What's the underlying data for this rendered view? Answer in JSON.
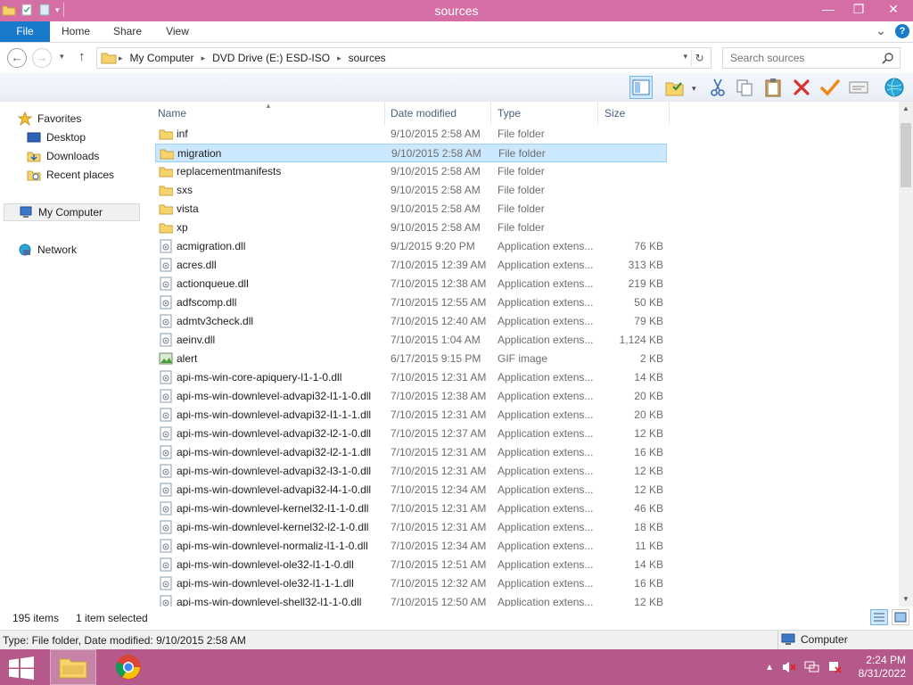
{
  "window": {
    "title": "sources"
  },
  "window_controls": {
    "minimize": "—",
    "maximize": "❐",
    "close": "✕"
  },
  "ribbon": {
    "tabs": [
      "File",
      "Home",
      "Share",
      "View"
    ],
    "expand_glyph": "⌄",
    "help_glyph": "?"
  },
  "nav": {
    "back_glyph": "←",
    "forward_glyph": "→",
    "recent_glyph": "▾",
    "up_glyph": "↑"
  },
  "address": {
    "crumbs": [
      "My Computer",
      "DVD Drive (E:) ESD-ISO",
      "sources"
    ],
    "separator": "▸"
  },
  "search": {
    "placeholder": "Search sources"
  },
  "navpane": {
    "favorites": "Favorites",
    "desktop": "Desktop",
    "downloads": "Downloads",
    "recent_places": "Recent places",
    "my_computer": "My Computer",
    "network": "Network"
  },
  "columns": {
    "name": "Name",
    "date": "Date modified",
    "type": "Type",
    "size": "Size"
  },
  "files": [
    {
      "name": "inf",
      "date": "9/10/2015 2:58 AM",
      "type": "File folder",
      "size": "",
      "icon": "folder"
    },
    {
      "name": "migration",
      "date": "9/10/2015 2:58 AM",
      "type": "File folder",
      "size": "",
      "icon": "folder",
      "selected": true
    },
    {
      "name": "replacementmanifests",
      "date": "9/10/2015 2:58 AM",
      "type": "File folder",
      "size": "",
      "icon": "folder"
    },
    {
      "name": "sxs",
      "date": "9/10/2015 2:58 AM",
      "type": "File folder",
      "size": "",
      "icon": "folder"
    },
    {
      "name": "vista",
      "date": "9/10/2015 2:58 AM",
      "type": "File folder",
      "size": "",
      "icon": "folder"
    },
    {
      "name": "xp",
      "date": "9/10/2015 2:58 AM",
      "type": "File folder",
      "size": "",
      "icon": "folder"
    },
    {
      "name": "acmigration.dll",
      "date": "9/1/2015 9:20 PM",
      "type": "Application extens...",
      "size": "76 KB",
      "icon": "dll"
    },
    {
      "name": "acres.dll",
      "date": "7/10/2015 12:39 AM",
      "type": "Application extens...",
      "size": "313 KB",
      "icon": "dll"
    },
    {
      "name": "actionqueue.dll",
      "date": "7/10/2015 12:38 AM",
      "type": "Application extens...",
      "size": "219 KB",
      "icon": "dll"
    },
    {
      "name": "adfscomp.dll",
      "date": "7/10/2015 12:55 AM",
      "type": "Application extens...",
      "size": "50 KB",
      "icon": "dll"
    },
    {
      "name": "admtv3check.dll",
      "date": "7/10/2015 12:40 AM",
      "type": "Application extens...",
      "size": "79 KB",
      "icon": "dll"
    },
    {
      "name": "aeinv.dll",
      "date": "7/10/2015 1:04 AM",
      "type": "Application extens...",
      "size": "1,124 KB",
      "icon": "dll"
    },
    {
      "name": "alert",
      "date": "6/17/2015 9:15 PM",
      "type": "GIF image",
      "size": "2 KB",
      "icon": "gif"
    },
    {
      "name": "api-ms-win-core-apiquery-l1-1-0.dll",
      "date": "7/10/2015 12:31 AM",
      "type": "Application extens...",
      "size": "14 KB",
      "icon": "dll"
    },
    {
      "name": "api-ms-win-downlevel-advapi32-l1-1-0.dll",
      "date": "7/10/2015 12:38 AM",
      "type": "Application extens...",
      "size": "20 KB",
      "icon": "dll"
    },
    {
      "name": "api-ms-win-downlevel-advapi32-l1-1-1.dll",
      "date": "7/10/2015 12:31 AM",
      "type": "Application extens...",
      "size": "20 KB",
      "icon": "dll"
    },
    {
      "name": "api-ms-win-downlevel-advapi32-l2-1-0.dll",
      "date": "7/10/2015 12:37 AM",
      "type": "Application extens...",
      "size": "12 KB",
      "icon": "dll"
    },
    {
      "name": "api-ms-win-downlevel-advapi32-l2-1-1.dll",
      "date": "7/10/2015 12:31 AM",
      "type": "Application extens...",
      "size": "16 KB",
      "icon": "dll"
    },
    {
      "name": "api-ms-win-downlevel-advapi32-l3-1-0.dll",
      "date": "7/10/2015 12:31 AM",
      "type": "Application extens...",
      "size": "12 KB",
      "icon": "dll"
    },
    {
      "name": "api-ms-win-downlevel-advapi32-l4-1-0.dll",
      "date": "7/10/2015 12:34 AM",
      "type": "Application extens...",
      "size": "12 KB",
      "icon": "dll"
    },
    {
      "name": "api-ms-win-downlevel-kernel32-l1-1-0.dll",
      "date": "7/10/2015 12:31 AM",
      "type": "Application extens...",
      "size": "46 KB",
      "icon": "dll"
    },
    {
      "name": "api-ms-win-downlevel-kernel32-l2-1-0.dll",
      "date": "7/10/2015 12:31 AM",
      "type": "Application extens...",
      "size": "18 KB",
      "icon": "dll"
    },
    {
      "name": "api-ms-win-downlevel-normaliz-l1-1-0.dll",
      "date": "7/10/2015 12:34 AM",
      "type": "Application extens...",
      "size": "11 KB",
      "icon": "dll"
    },
    {
      "name": "api-ms-win-downlevel-ole32-l1-1-0.dll",
      "date": "7/10/2015 12:51 AM",
      "type": "Application extens...",
      "size": "14 KB",
      "icon": "dll"
    },
    {
      "name": "api-ms-win-downlevel-ole32-l1-1-1.dll",
      "date": "7/10/2015 12:32 AM",
      "type": "Application extens...",
      "size": "16 KB",
      "icon": "dll"
    },
    {
      "name": "api-ms-win-downlevel-shell32-l1-1-0.dll",
      "date": "7/10/2015 12:50 AM",
      "type": "Application extens...",
      "size": "12 KB",
      "icon": "dll"
    }
  ],
  "status": {
    "item_count": "195 items",
    "selected": "1 item selected"
  },
  "details": {
    "text": "Type: File folder, Date modified: 9/10/2015 2:58 AM",
    "zone": "Computer"
  },
  "clock": {
    "time": "2:24 PM",
    "date": "8/31/2022"
  },
  "colors": {
    "titlebar": "#d66ea6",
    "taskbar": "#b5588a",
    "file_tab": "#1979ca",
    "selection": "#cce8ff"
  }
}
